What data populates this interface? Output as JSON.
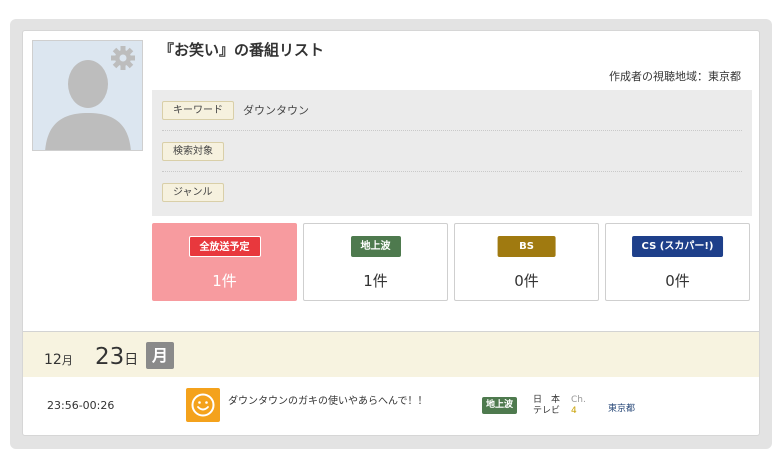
{
  "list": {
    "title": "『お笑い』の番組リスト",
    "region": "作成者の視聴地域：東京都"
  },
  "conditions": [
    {
      "label": "キーワード",
      "value": "ダウンタウン"
    },
    {
      "label": "検索対象",
      "value": ""
    },
    {
      "label": "ジャンル",
      "value": ""
    }
  ],
  "stats": [
    {
      "label": "全放送予定",
      "count": "1件",
      "color": "#e8383d"
    },
    {
      "label": "地上波",
      "count": "1件",
      "color": "#4e7a4e"
    },
    {
      "label": "BS",
      "count": "0件",
      "color": "#a07a10"
    },
    {
      "label": "CS (スカパー!)",
      "count": "0件",
      "color": "#1e3f8a"
    }
  ],
  "date": {
    "month": "12",
    "month_unit": "月",
    "day": "23",
    "day_unit": "日",
    "weekday": "月"
  },
  "programs": [
    {
      "time": "23:56-00:26",
      "icon": "smiley-icon",
      "title": "ダウンタウンのガキの使いやあらへんで！！",
      "broadcast": "地上波",
      "station_line1": "日　本",
      "station_line2": "テレビ",
      "ch_label": "Ch.",
      "ch_num": "4",
      "area": "東京都"
    }
  ]
}
